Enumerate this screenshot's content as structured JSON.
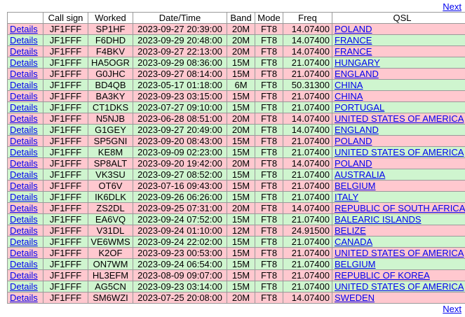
{
  "pager": {
    "next_label": "Next"
  },
  "colors": {
    "row_a": "#ffc8cf",
    "row_b": "#cff5cf",
    "link": "#0000ee",
    "border": "#9a9a9a"
  },
  "columns": [
    "",
    "Call sign",
    "Worked",
    "Date/Time",
    "Band",
    "Mode",
    "Freq",
    "QSL"
  ],
  "rows": [
    {
      "details": "Details",
      "call": "JF1FFF",
      "worked": "SP1HF",
      "datetime": "2023-09-27 20:39:00",
      "band": "20M",
      "mode": "FT8",
      "freq": "14.07400",
      "qsl": "POLAND",
      "shade": "a"
    },
    {
      "details": "Details",
      "call": "JF1FFF",
      "worked": "F6DHD",
      "datetime": "2023-09-29 20:48:00",
      "band": "20M",
      "mode": "FT8",
      "freq": "14.07400",
      "qsl": "FRANCE",
      "shade": "b"
    },
    {
      "details": "Details",
      "call": "JF1FFF",
      "worked": "F4BKV",
      "datetime": "2023-09-27 22:13:00",
      "band": "20M",
      "mode": "FT8",
      "freq": "14.07400",
      "qsl": "FRANCE",
      "shade": "a"
    },
    {
      "details": "Details",
      "call": "JF1FFF",
      "worked": "HA5OGR",
      "datetime": "2023-09-29 08:36:00",
      "band": "15M",
      "mode": "FT8",
      "freq": "21.07400",
      "qsl": "HUNGARY",
      "shade": "b"
    },
    {
      "details": "Details",
      "call": "JF1FFF",
      "worked": "G0JHC",
      "datetime": "2023-09-27 08:14:00",
      "band": "15M",
      "mode": "FT8",
      "freq": "21.07400",
      "qsl": "ENGLAND",
      "shade": "a"
    },
    {
      "details": "Details",
      "call": "JF1FFF",
      "worked": "BD4QB",
      "datetime": "2023-05-17 01:18:00",
      "band": "6M",
      "mode": "FT8",
      "freq": "50.31300",
      "qsl": "CHINA",
      "shade": "b"
    },
    {
      "details": "Details",
      "call": "JF1FFF",
      "worked": "BA3KY",
      "datetime": "2023-09-23 03:15:00",
      "band": "15M",
      "mode": "FT8",
      "freq": "21.07400",
      "qsl": "CHINA",
      "shade": "a"
    },
    {
      "details": "Details",
      "call": "JF1FFF",
      "worked": "CT1DKS",
      "datetime": "2023-07-27 09:10:00",
      "band": "15M",
      "mode": "FT8",
      "freq": "21.07400",
      "qsl": "PORTUGAL",
      "shade": "b"
    },
    {
      "details": "Details",
      "call": "JF1FFF",
      "worked": "N5NJB",
      "datetime": "2023-06-28 08:51:00",
      "band": "20M",
      "mode": "FT8",
      "freq": "14.07400",
      "qsl": "UNITED STATES OF AMERICA",
      "shade": "a"
    },
    {
      "details": "Details",
      "call": "JF1FFF",
      "worked": "G1GEY",
      "datetime": "2023-09-27 20:49:00",
      "band": "20M",
      "mode": "FT8",
      "freq": "14.07400",
      "qsl": "ENGLAND",
      "shade": "b"
    },
    {
      "details": "Details",
      "call": "JF1FFF",
      "worked": "SP5GNI",
      "datetime": "2023-09-20 08:43:00",
      "band": "15M",
      "mode": "FT8",
      "freq": "21.07400",
      "qsl": "POLAND",
      "shade": "a"
    },
    {
      "details": "Details",
      "call": "JF1FFF",
      "worked": "KE8M",
      "datetime": "2023-09-09 02:23:00",
      "band": "15M",
      "mode": "FT8",
      "freq": "21.07400",
      "qsl": "UNITED STATES OF AMERICA",
      "shade": "b"
    },
    {
      "details": "Details",
      "call": "JF1FFF",
      "worked": "SP8ALT",
      "datetime": "2023-09-20 19:42:00",
      "band": "20M",
      "mode": "FT8",
      "freq": "14.07400",
      "qsl": "POLAND",
      "shade": "a"
    },
    {
      "details": "Details",
      "call": "JF1FFF",
      "worked": "VK3SU",
      "datetime": "2023-09-27 08:52:00",
      "band": "15M",
      "mode": "FT8",
      "freq": "21.07400",
      "qsl": "AUSTRALIA",
      "shade": "b"
    },
    {
      "details": "Details",
      "call": "JF1FFF",
      "worked": "OT6V",
      "datetime": "2023-07-16 09:43:00",
      "band": "15M",
      "mode": "FT8",
      "freq": "21.07400",
      "qsl": "BELGIUM",
      "shade": "a"
    },
    {
      "details": "Details",
      "call": "JF1FFF",
      "worked": "IK6DLK",
      "datetime": "2023-09-26 06:26:00",
      "band": "15M",
      "mode": "FT8",
      "freq": "21.07400",
      "qsl": "ITALY",
      "shade": "b"
    },
    {
      "details": "Details",
      "call": "JF1FFF",
      "worked": "ZS2DL",
      "datetime": "2023-09-25 07:31:00",
      "band": "20M",
      "mode": "FT8",
      "freq": "14.07400",
      "qsl": "REPUBLIC OF SOUTH AFRICA",
      "shade": "a"
    },
    {
      "details": "Details",
      "call": "JF1FFF",
      "worked": "EA6VQ",
      "datetime": "2023-09-24 07:52:00",
      "band": "15M",
      "mode": "FT8",
      "freq": "21.07400",
      "qsl": "BALEARIC ISLANDS",
      "shade": "b"
    },
    {
      "details": "Details",
      "call": "JF1FFF",
      "worked": "V31DL",
      "datetime": "2023-09-24 01:10:00",
      "band": "12M",
      "mode": "FT8",
      "freq": "24.91500",
      "qsl": "BELIZE",
      "shade": "a"
    },
    {
      "details": "Details",
      "call": "JF1FFF",
      "worked": "VE6WMS",
      "datetime": "2023-09-24 22:02:00",
      "band": "15M",
      "mode": "FT8",
      "freq": "21.07400",
      "qsl": "CANADA",
      "shade": "b"
    },
    {
      "details": "Details",
      "call": "JF1FFF",
      "worked": "K2OF",
      "datetime": "2023-09-23 00:53:00",
      "band": "15M",
      "mode": "FT8",
      "freq": "21.07400",
      "qsl": "UNITED STATES OF AMERICA",
      "shade": "a"
    },
    {
      "details": "Details",
      "call": "JF1FFF",
      "worked": "ON7WM",
      "datetime": "2023-09-24 06:54:00",
      "band": "15M",
      "mode": "FT8",
      "freq": "21.07400",
      "qsl": "BELGIUM",
      "shade": "b"
    },
    {
      "details": "Details",
      "call": "JF1FFF",
      "worked": "HL3EFM",
      "datetime": "2023-08-09 09:07:00",
      "band": "15M",
      "mode": "FT8",
      "freq": "21.07400",
      "qsl": "REPUBLIC OF KOREA",
      "shade": "a"
    },
    {
      "details": "Details",
      "call": "JF1FFF",
      "worked": "AG5CN",
      "datetime": "2023-09-23 03:14:00",
      "band": "15M",
      "mode": "FT8",
      "freq": "21.07400",
      "qsl": "UNITED STATES OF AMERICA",
      "shade": "b"
    },
    {
      "details": "Details",
      "call": "JF1FFF",
      "worked": "SM6WZI",
      "datetime": "2023-07-25 20:08:00",
      "band": "20M",
      "mode": "FT8",
      "freq": "14.07400",
      "qsl": "SWEDEN",
      "shade": "a"
    }
  ]
}
